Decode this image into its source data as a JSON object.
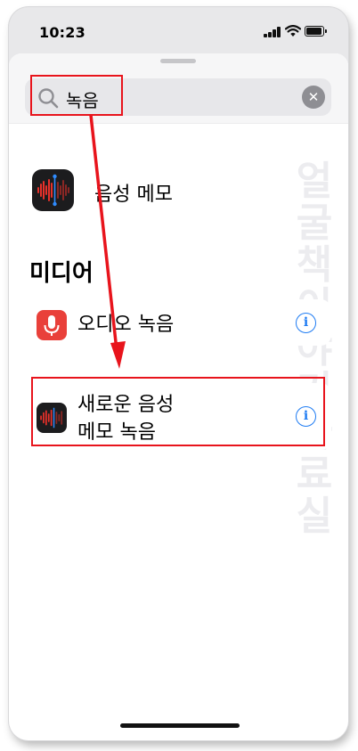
{
  "status_bar": {
    "time": "10:23"
  },
  "search": {
    "query": "녹음",
    "clear_glyph": "✕"
  },
  "app_result": {
    "label": "음성 메모",
    "icon": "voice-memos-icon"
  },
  "section": {
    "title": "미디어"
  },
  "actions": [
    {
      "label": "오디오 녹음",
      "icon": "microphone-icon"
    },
    {
      "label_line1": "새로운 음성",
      "label_line2": "메모 녹음",
      "icon": "voice-memos-icon"
    }
  ],
  "info_glyph": "i",
  "watermark": "얼굴책이야기자료실",
  "colors": {
    "highlight": "#e8141c",
    "accent_blue": "#1f7cf3",
    "mic_red": "#e9403a"
  }
}
